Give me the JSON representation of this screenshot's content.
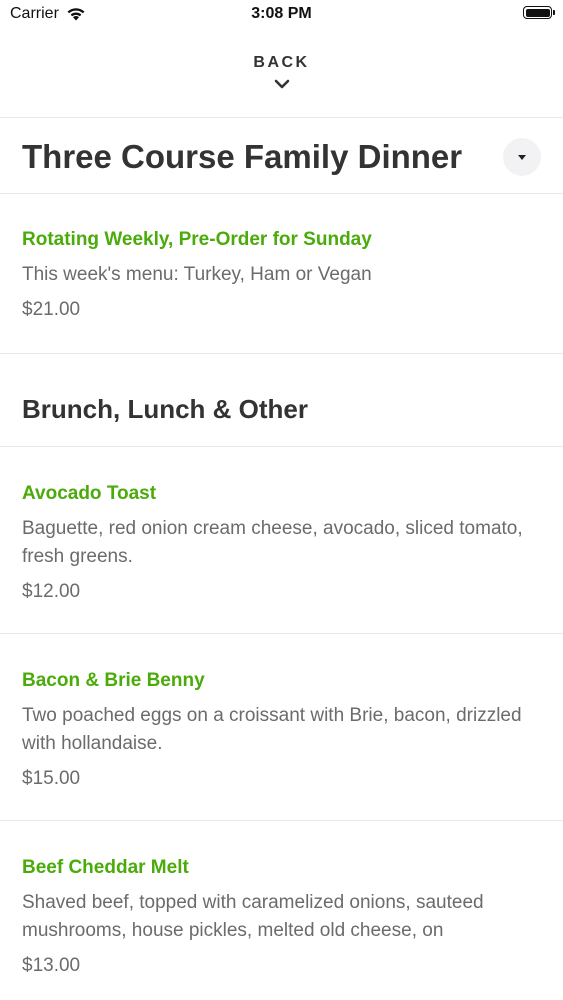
{
  "status_bar": {
    "carrier": "Carrier",
    "time": "3:08 PM",
    "icons": [
      "wifi-icon",
      "battery-icon"
    ]
  },
  "nav": {
    "back_label": "BACK",
    "back_icon": "chevron-down-icon"
  },
  "sections": {
    "family_dinner": {
      "title": "Three Course Family Dinner",
      "toggle_icon": "caret-down-icon",
      "items": [
        {
          "name": "Rotating Weekly, Pre-Order for Sunday",
          "description": "This week's menu: Turkey, Ham or Vegan",
          "price": "$21.00"
        }
      ]
    },
    "brunch": {
      "title": "Brunch, Lunch & Other",
      "items": [
        {
          "name": "Avocado Toast",
          "description": "Baguette, red onion cream cheese, avocado, sliced tomato, fresh greens.",
          "price": "$12.00"
        },
        {
          "name": "Bacon & Brie Benny",
          "description": "Two poached eggs on a croissant with Brie, bacon, drizzled with hollandaise.",
          "price": "$15.00"
        },
        {
          "name": "Beef Cheddar Melt",
          "description": "Shaved beef, topped with caramelized onions, sauteed mushrooms, house pickles, melted old cheese, on",
          "price": "$13.00"
        }
      ]
    }
  },
  "colors": {
    "accent": "#4aab0a",
    "text_primary": "#333333",
    "text_secondary": "#6b6b6b",
    "divider": "#e8e8e8"
  }
}
